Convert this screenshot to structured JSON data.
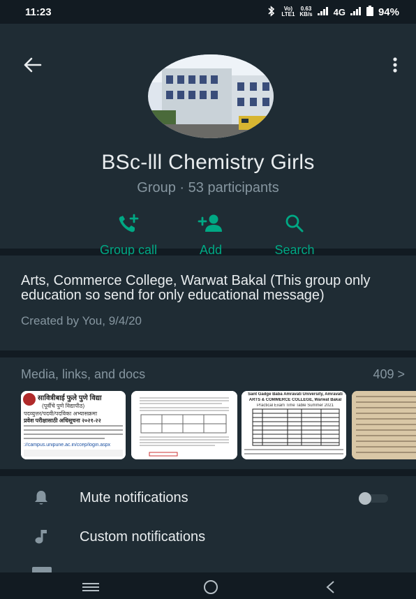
{
  "status_bar": {
    "time": "11:23",
    "volte_top": "Vo)",
    "volte_bottom": "LTE1",
    "speed_top": "0.63",
    "speed_bottom": "KB/s",
    "network": "4G",
    "battery": "94%"
  },
  "header": {
    "group_name": "BSc-lll Chemistry Girls",
    "subtitle": "Group · 53 participants",
    "actions": [
      {
        "label": "Group call",
        "icon": "add-call-icon"
      },
      {
        "label": "Add",
        "icon": "add-person-icon"
      },
      {
        "label": "Search",
        "icon": "search-icon"
      }
    ]
  },
  "description": {
    "text": "Arts, Commerce College, Warwat Bakal (This group only education so send for only educational message)",
    "created": "Created by You, 9/4/20"
  },
  "media": {
    "label": "Media, links, and docs",
    "count": "409 >",
    "thumb1": {
      "heading": "सावित्रीबाई फुले पुणे विद्या",
      "subheading": "(पूर्वीचे पुणे विद्यापीठ)",
      "line1": "पदव्युत्तर/पदवी/पदविका अभ्यासक्रमा",
      "line2": "प्रवेश परीक्षासाठी अधिसूचना २०२१-२२",
      "link": "://campus.unipune.ac.in/ccep/login.aspx"
    },
    "thumb3": {
      "heading": "Sant Gadge Baba Amravati University, Amravati",
      "subheading": "ARTS & COMMERCE COLLEGE, Warwat Bakal",
      "line1": "Practical Exam Time Table Summer 2021"
    }
  },
  "settings": [
    {
      "label": "Mute notifications",
      "icon": "bell-icon"
    },
    {
      "label": "Custom notifications",
      "icon": "music-note-icon"
    }
  ],
  "colors": {
    "accent": "#00a884",
    "background": "#121b22",
    "card": "#1f2c34",
    "secondary_text": "#8696a0"
  }
}
